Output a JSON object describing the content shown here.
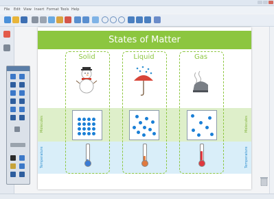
{
  "window": {
    "menu_items": [
      "File",
      "Edit",
      "View",
      "Insert",
      "Format",
      "Tools",
      "Help"
    ]
  },
  "slide": {
    "title": "States of Matter",
    "columns": [
      {
        "label": "Solid",
        "temperature_level": 0.25,
        "thermo_color": "#3a7bd5"
      },
      {
        "label": "Liquid",
        "temperature_level": 0.5,
        "thermo_color": "#e07a3f"
      },
      {
        "label": "Gas",
        "temperature_level": 0.8,
        "thermo_color": "#e0383f"
      }
    ],
    "band_labels": {
      "green": "Molecules",
      "blue": "Temperature"
    }
  },
  "colors": {
    "title_bar": "#8cc63f",
    "molecule": "#1a7fd6",
    "green_band": "#deefca",
    "blue_band": "#d9eef9"
  }
}
